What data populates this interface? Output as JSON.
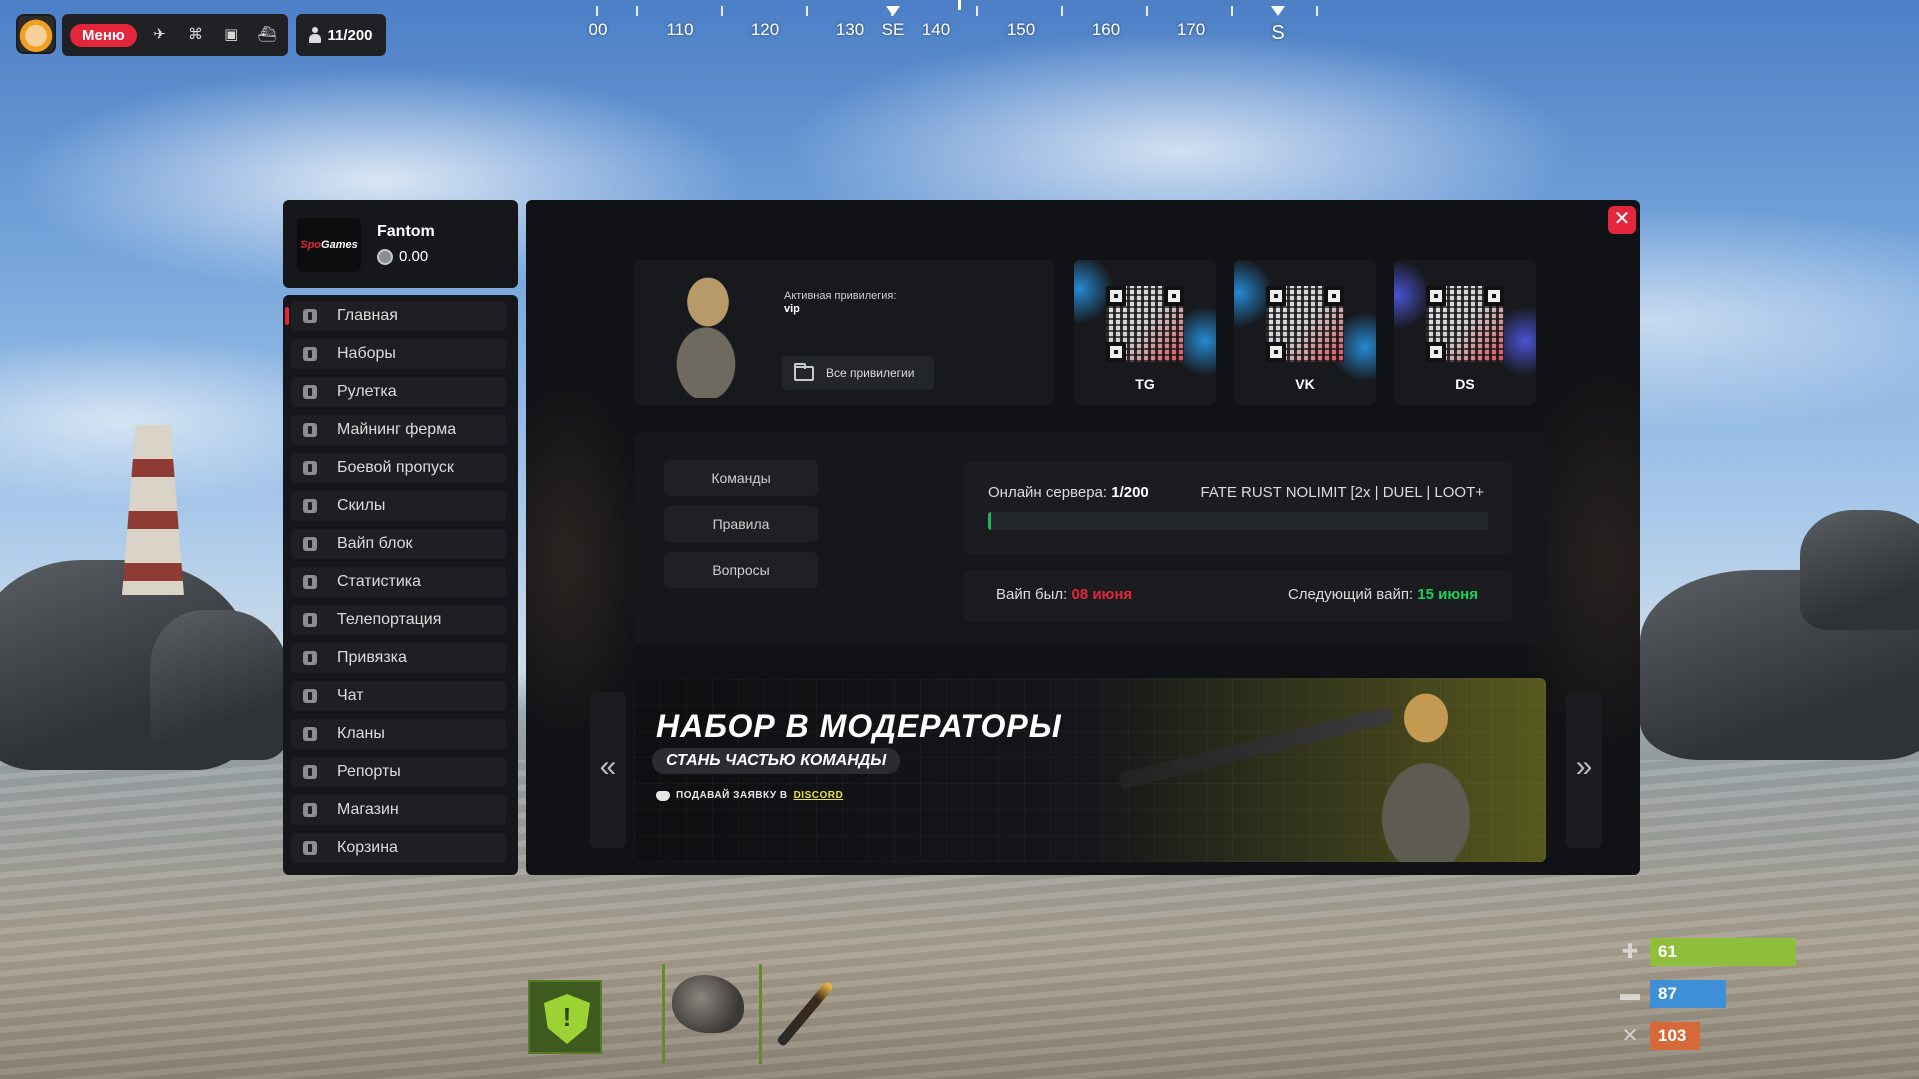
{
  "topbar": {
    "menu_label": "Меню",
    "players": "11/200"
  },
  "compass": {
    "labels": [
      "00",
      "110",
      "120",
      "130",
      "SE",
      "140",
      "150",
      "160",
      "170",
      "S"
    ]
  },
  "profile": {
    "brand_red": "Spo",
    "brand_white": "Games",
    "name": "Fantom",
    "balance": "0.00"
  },
  "sidebar": {
    "items": [
      {
        "label": "Главная"
      },
      {
        "label": "Наборы"
      },
      {
        "label": "Рулетка"
      },
      {
        "label": "Майнинг ферма"
      },
      {
        "label": "Боевой пропуск"
      },
      {
        "label": "Скилы"
      },
      {
        "label": "Вайп блок"
      },
      {
        "label": "Статистика"
      },
      {
        "label": "Телепортация"
      },
      {
        "label": "Привязка"
      },
      {
        "label": "Чат"
      },
      {
        "label": "Кланы"
      },
      {
        "label": "Репорты"
      },
      {
        "label": "Магазин"
      },
      {
        "label": "Корзина"
      }
    ]
  },
  "main": {
    "close_label": "✕",
    "privilege": {
      "title": "Активная привилегия:",
      "value": "vip",
      "all_button": "Все привилегии"
    },
    "socials": [
      {
        "label": "TG"
      },
      {
        "label": "VK"
      },
      {
        "label": "DS"
      }
    ],
    "info_buttons": [
      {
        "label": "Команды"
      },
      {
        "label": "Правила"
      },
      {
        "label": "Вопросы"
      }
    ],
    "online": {
      "label": "Онлайн сервера:",
      "value": "1/200",
      "fraction": 0.005,
      "server_name": "FATE RUST NOLIMIT [2x | DUEL | LOOT+"
    },
    "wipe": {
      "last_label": "Вайп был:",
      "last_value": "08 июня",
      "next_label": "Следующий вайп:",
      "next_value": "15 июня"
    },
    "banner": {
      "title": "НАБОР В МОДЕРАТОРЫ",
      "subtitle": "СТАНЬ ЧАСТЬЮ КОМАНДЫ",
      "cta_prefix": "ПОДАВАЙ ЗАЯВКУ В",
      "cta_link": "DISCORD"
    },
    "prev_arrow": "«",
    "next_arrow": "»"
  },
  "vitals": {
    "health": "61",
    "water": "87",
    "food": "103",
    "health_color": "#8fbf3a",
    "water_color": "#3f8fd6",
    "food_color": "#d5693a"
  }
}
